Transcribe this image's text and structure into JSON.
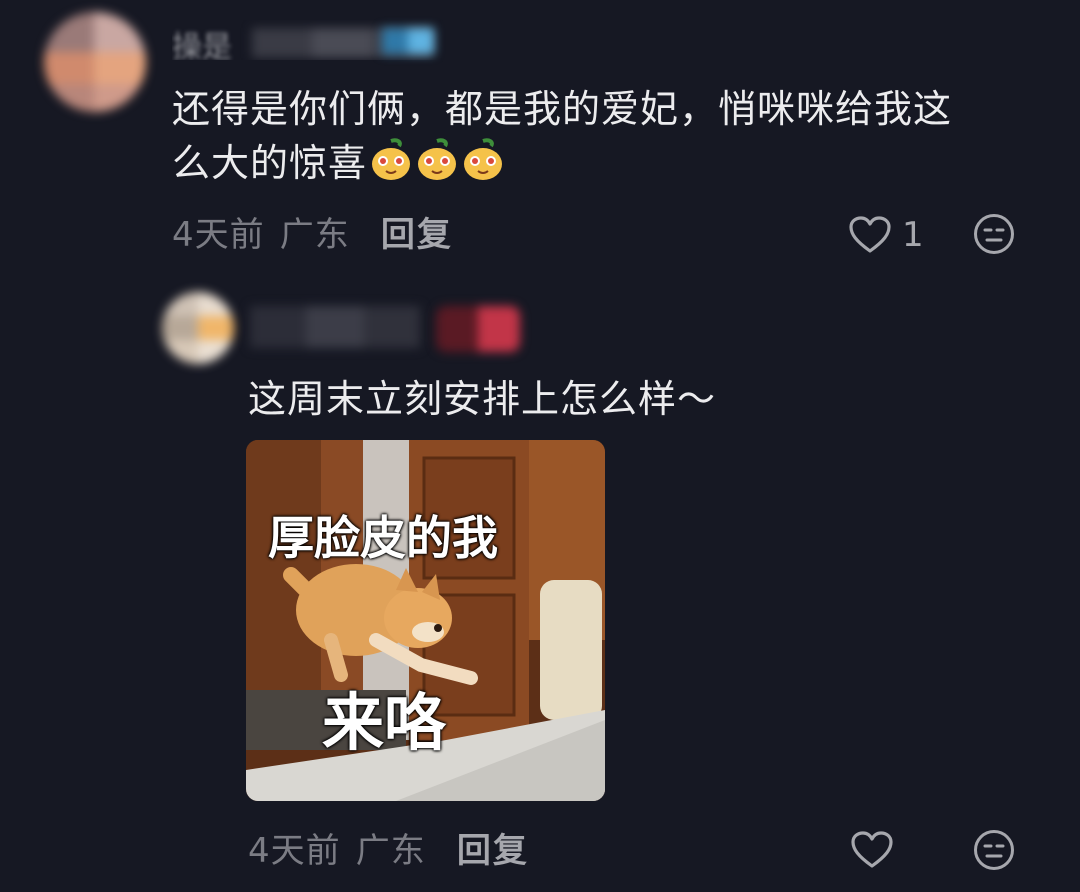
{
  "comments": [
    {
      "username_fragment": "操是",
      "text_line1": "还得是你们俩，都是我的爱妃，悄咪咪给我这",
      "text_line2": "么大的惊喜",
      "emoji_icon": "smiling-mango-emoji",
      "meta_time": "4天前",
      "meta_location": "广东",
      "reply_label": "回复",
      "like_count": "1"
    },
    {
      "text": "这周末立刻安排上怎么样～",
      "sticker": {
        "caption_top": "厚脸皮的我",
        "caption_bottom": "来咯",
        "subject": "shiba-dog-jumping"
      },
      "meta_time": "4天前",
      "meta_location": "广东",
      "reply_label": "回复"
    }
  ],
  "colors": {
    "background": "#161823",
    "primary_text": "#ececee",
    "secondary_text": "#7b7c84"
  }
}
